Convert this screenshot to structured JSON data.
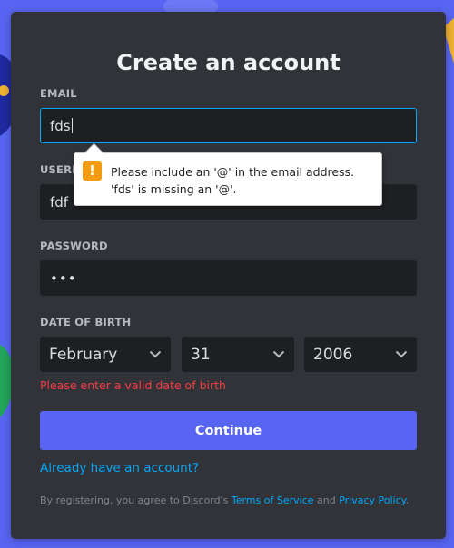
{
  "title": "Create an account",
  "email": {
    "label": "EMAIL",
    "value": "fds"
  },
  "username": {
    "label": "USERNAME",
    "value": "fdf"
  },
  "password": {
    "label": "PASSWORD",
    "value": "•••"
  },
  "dob": {
    "label": "DATE OF BIRTH",
    "month": "February",
    "day": "31",
    "year": "2006",
    "error": "Please enter a valid date of birth"
  },
  "continue_label": "Continue",
  "login_link": "Already have an account?",
  "legal": {
    "prefix": "By registering, you agree to Discord's ",
    "tos": "Terms of Service",
    "and": " and ",
    "privacy": "Privacy Policy",
    "suffix": "."
  },
  "tooltip": {
    "icon": "!",
    "message": "Please include an '@' in the email address. 'fds' is missing an '@'."
  },
  "colors": {
    "brand": "#5865f2",
    "link": "#00a8fc",
    "error": "#f23f43",
    "card": "#313338",
    "input": "#1e1f22"
  }
}
